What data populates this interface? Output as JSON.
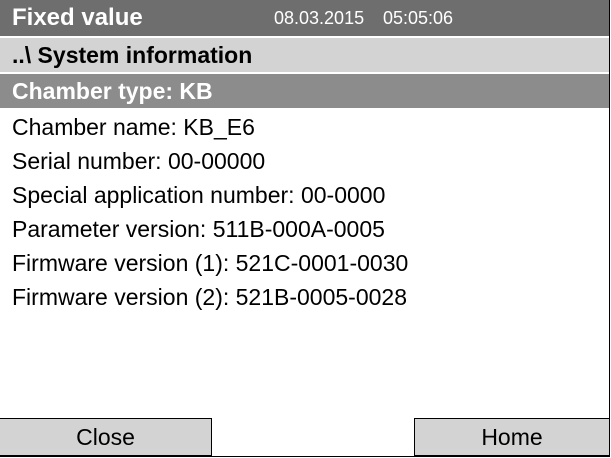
{
  "status_bar": {
    "mode": "Fixed value",
    "date": "08.03.2015",
    "time": "05:05:06"
  },
  "breadcrumb": "..\\ System information",
  "selected_item": "Chamber type: KB",
  "info_lines": [
    "Chamber name: KB_E6",
    "Serial number: 00-00000",
    "Special application number: 00-0000",
    "Parameter version: 511B-000A-0005",
    "Firmware version (1): 521C-0001-0030",
    "Firmware version (2): 521B-0005-0028"
  ],
  "buttons": {
    "close": "Close",
    "home": "Home"
  },
  "colors": {
    "status_bar": "#6e6e6e",
    "breadcrumb_bar": "#d3d3d3",
    "selected_row": "#8c8c8c",
    "button": "#d3d3d3"
  }
}
